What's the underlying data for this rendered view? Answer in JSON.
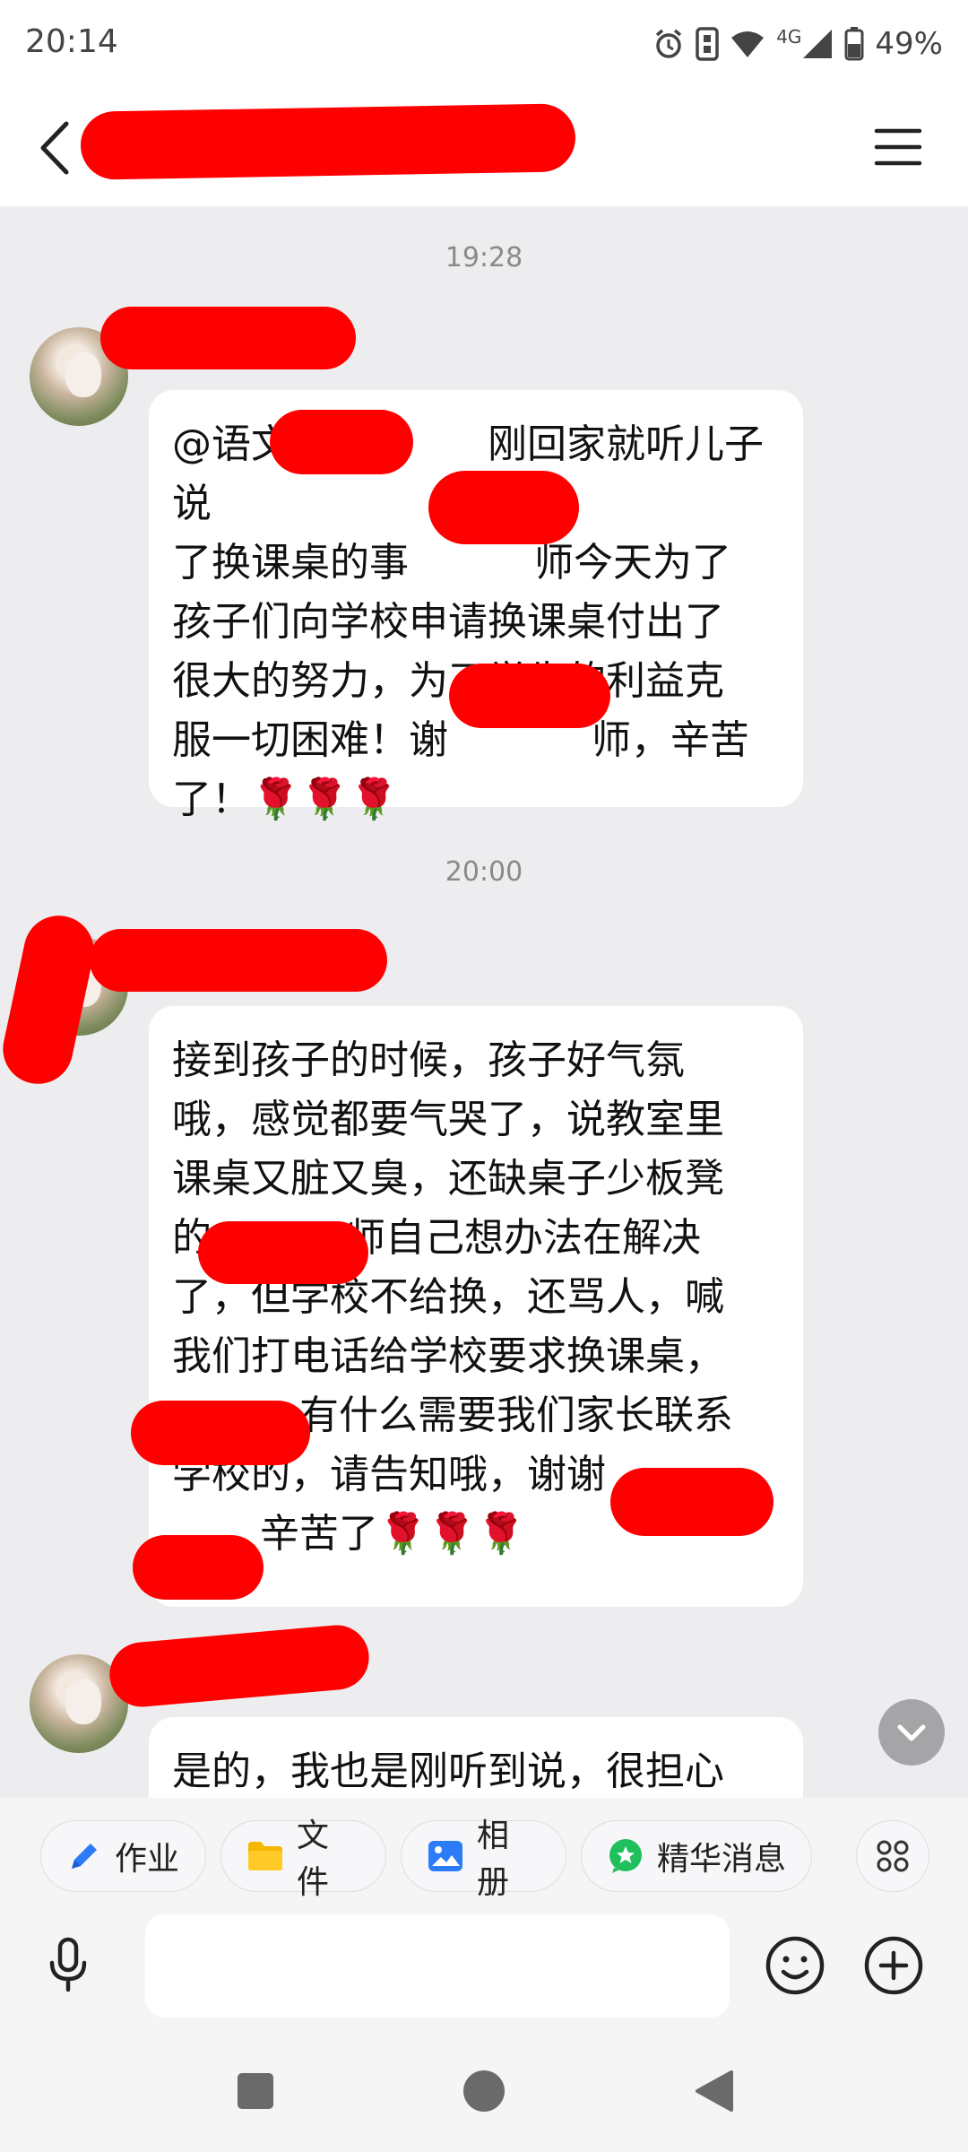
{
  "status_bar": {
    "time": "20:14",
    "network": "4G",
    "battery": "49%",
    "icons": [
      "alarm-icon",
      "vibrate-icon",
      "wifi-icon",
      "signal-icon",
      "battery-icon"
    ]
  },
  "header": {
    "back_icon": "chevron-left-icon",
    "menu_icon": "hamburger-menu-icon"
  },
  "messages": [
    {
      "time": "19:28",
      "lines": [
        "@语文",
        "刚回家就听儿子说",
        "了换课桌的事",
        "师今天为了",
        "孩子们向学校申请换课桌付出了",
        "很大的努力，为了学生的利益克",
        "服一切困难！谢",
        "师，辛苦",
        "了！🌹🌹🌹"
      ]
    },
    {
      "time": "20:00",
      "lines": [
        "接到孩子的时候，孩子好气氛",
        "哦，感觉都要气哭了，说教室里",
        "课桌又脏又臭，还缺桌子少板凳",
        "的",
        "师自己想办法在解决",
        "了，但学校不给换，还骂人，喊",
        "我们打电话给学校要求换课桌，",
        "有什么需要我们家长联系",
        "学校的，请告知哦，谢谢",
        "辛苦了🌹🌹🌹"
      ]
    },
    {
      "lines": [
        "是的，我也是刚听到说，很担心"
      ]
    }
  ],
  "toolbar": {
    "homework": "作业",
    "files": "文件",
    "album": "相册",
    "highlights": "精华消息"
  },
  "colors": {
    "accent_blue": "#2b7cf6",
    "folder_yellow": "#f5b800",
    "highlight_green": "#1fbf5b",
    "redaction": "#ff0000"
  }
}
